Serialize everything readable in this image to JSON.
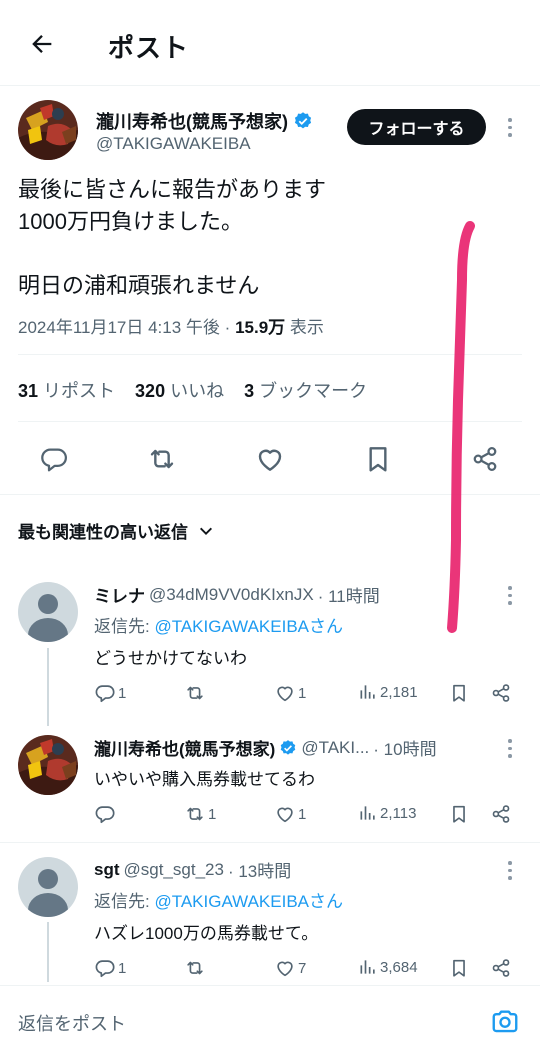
{
  "header": {
    "title": "ポスト"
  },
  "post": {
    "author_name": "瀧川寿希也(競馬予想家)",
    "author_handle": "@TAKIGAWAKEIBA",
    "follow_label": "フォローする",
    "text": "最後に皆さんに報告があります\n1000万円負けました。\n\n明日の浦和頑張れません",
    "timestamp": "2024年11月17日 4:13 午後",
    "separator": "·",
    "views_count": "15.9万",
    "views_label": "表示",
    "stats": {
      "reposts_count": "31",
      "reposts_label": "リポスト",
      "likes_count": "320",
      "likes_label": "いいね",
      "bookmarks_count": "3",
      "bookmarks_label": "ブックマーク"
    }
  },
  "replies_sort": {
    "label": "最も関連性の高い返信"
  },
  "replies": [
    {
      "name": "ミレナ",
      "handle": "@34dM9VV0dKIxnJX",
      "time": "· 11時間",
      "reply_to_prefix": "返信先: ",
      "reply_to": "@TAKIGAWAKEIBAさん",
      "text": "どうせかけてないわ",
      "replies": "1",
      "reposts": "",
      "likes": "1",
      "views": "2,181"
    },
    {
      "name": "瀧川寿希也(競馬予想家)",
      "handle": "@TAKI...",
      "time": "· 10時間",
      "text": "いやいや購入馬券載せてるわ",
      "replies": "",
      "reposts": "1",
      "likes": "1",
      "views": "2,113"
    },
    {
      "name": "sgt",
      "handle": "@sgt_sgt_23",
      "time": "· 13時間",
      "reply_to_prefix": "返信先: ",
      "reply_to": "@TAKIGAWAKEIBAさん",
      "text": "ハズレ1000万の馬券載せて。",
      "replies": "1",
      "reposts": "",
      "likes": "7",
      "views": "3,684"
    }
  ],
  "compose": {
    "placeholder": "返信をポスト"
  },
  "colors": {
    "accent": "#1d9bf0",
    "verified": "#1d9bf0",
    "annotation": "#e8246e"
  },
  "icons": [
    "back-arrow-icon",
    "verified-badge-icon",
    "more-icon",
    "reply-icon",
    "repost-icon",
    "like-icon",
    "bookmark-icon",
    "share-icon",
    "chevron-down-icon",
    "views-icon",
    "camera-icon"
  ]
}
